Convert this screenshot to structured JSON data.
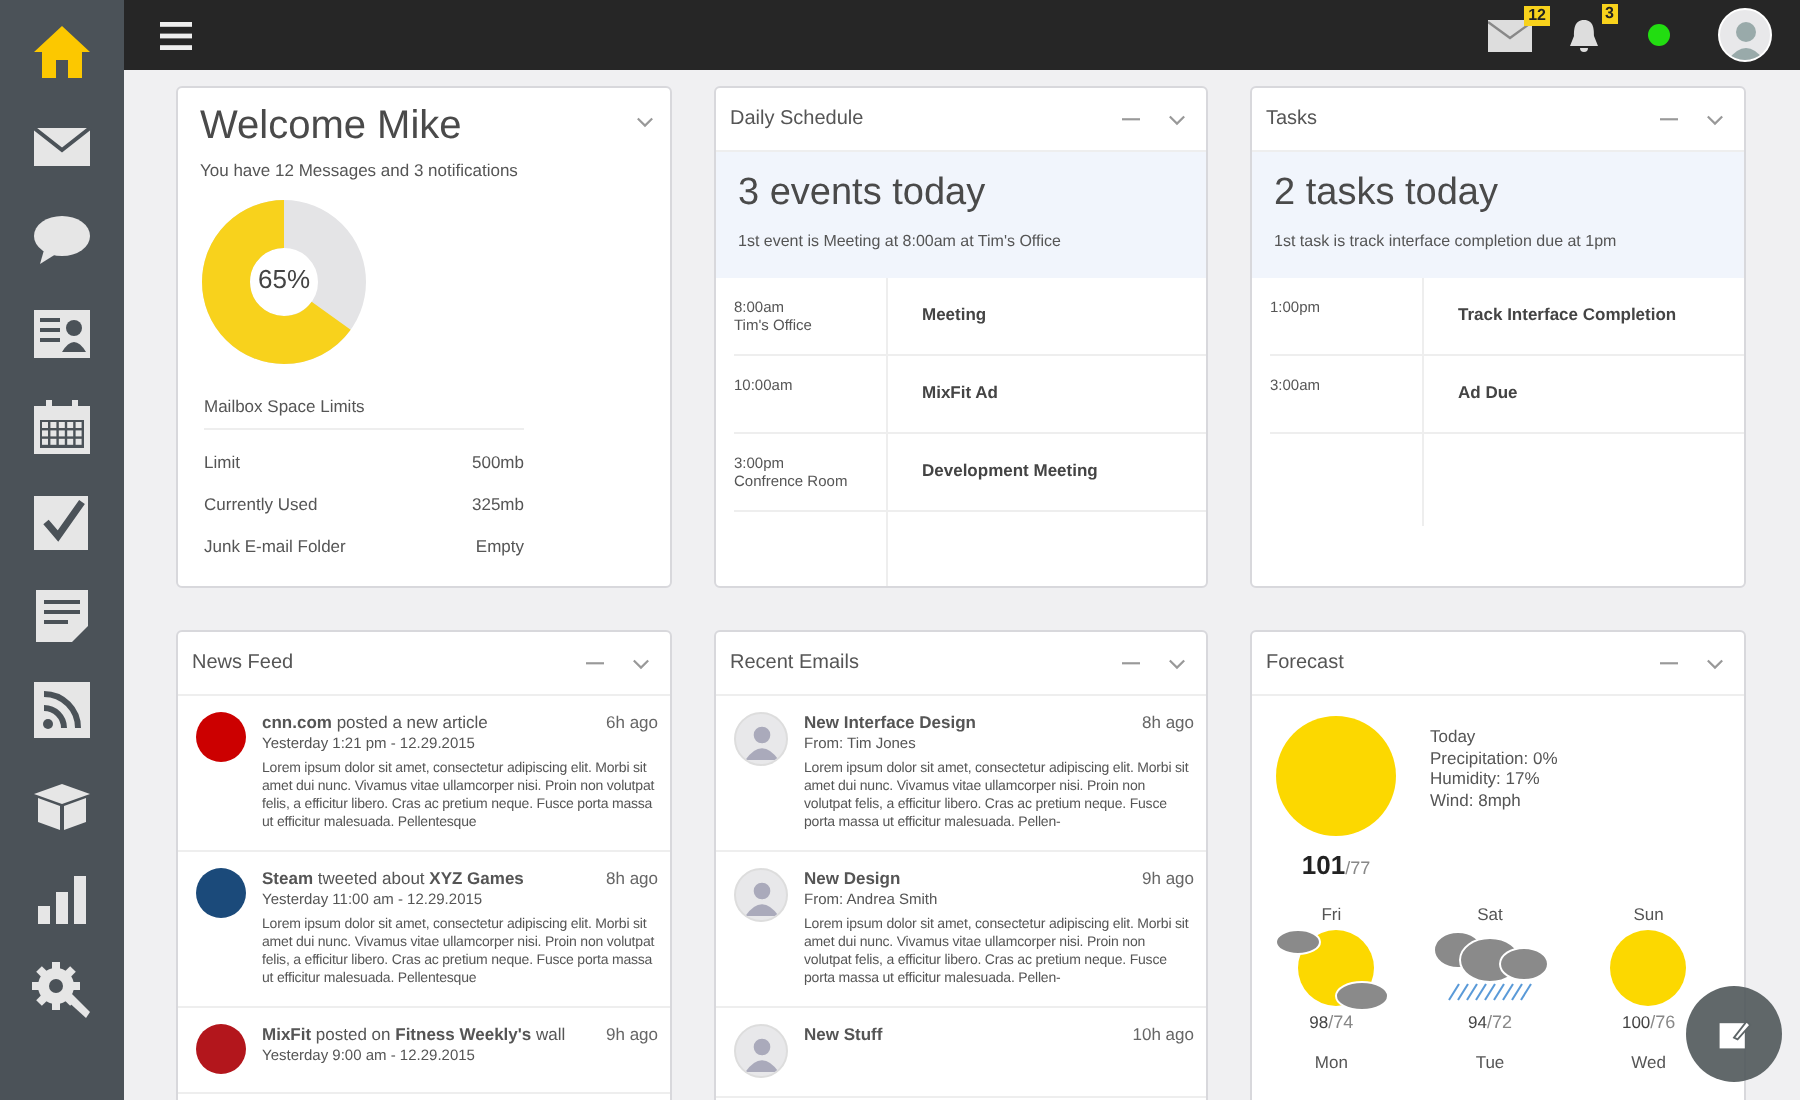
{
  "sidebar": {
    "items": [
      {
        "kind": "home",
        "selected": true
      },
      {
        "kind": "mail",
        "selected": false
      },
      {
        "kind": "chat",
        "selected": false
      },
      {
        "kind": "contacts",
        "selected": false
      },
      {
        "kind": "calendar",
        "selected": false
      },
      {
        "kind": "tasks",
        "selected": false
      },
      {
        "kind": "document",
        "selected": false
      },
      {
        "kind": "rss",
        "selected": false
      },
      {
        "kind": "box",
        "selected": false
      },
      {
        "kind": "stats",
        "selected": false
      },
      {
        "kind": "settings",
        "selected": false
      }
    ]
  },
  "topbar": {
    "mail_badge": "12",
    "notification_badge": "3",
    "online": true
  },
  "welcome": {
    "title": "Welcome Mike",
    "subtitle": "You have 12 Messages  and 3 notifications",
    "usage": {
      "level": 0.65,
      "label": "65%"
    },
    "limits_title": "Mailbox Space Limits",
    "limits": [
      {
        "label": "Limit",
        "value": "500mb"
      },
      {
        "label": "Currently Used",
        "value": "325mb"
      },
      {
        "label": "Junk E-mail Folder",
        "value": "Empty"
      }
    ]
  },
  "schedule": {
    "title": "Daily Schedule",
    "headline": "3 events today",
    "summary": "1st event is Meeting at 8:00am at Tim's Office",
    "events": [
      {
        "time": "8:00am",
        "place": "Tim's Office",
        "name": "Meeting"
      },
      {
        "time": "10:00am",
        "name": "MixFit Ad"
      },
      {
        "time": "3:00pm",
        "place": "Confrence Room",
        "name": "Development Meeting"
      }
    ]
  },
  "tasks": {
    "title": "Tasks",
    "headline": "2 tasks today",
    "summary": "1st task is track interface completion due at 1pm",
    "items": [
      {
        "time": "1:00pm",
        "name": "Track Interface Completion"
      },
      {
        "time": "3:00am",
        "name": "Ad Due"
      }
    ]
  },
  "news_feed": {
    "title": "News Feed",
    "items": [
      {
        "headline": "**cnn.com** posted a new article",
        "date": "Yesterday 1:21 pm - 12.29.2015",
        "ago": "6h ago",
        "color": "#cc0000",
        "body": "Lorem ipsum dolor sit amet, consectetur adipiscing elit. Morbi sit amet dui nunc. Vivamus vitae ullamcorper nisi. Proin non volutpat felis, a efficitur libero. Cras ac pretium neque. Fusce porta massa ut efficitur malesuada. Pellentesque"
      },
      {
        "headline": "**Steam** tweeted about **XYZ Games**",
        "date": "Yesterday 11:00 am - 12.29.2015",
        "ago": "8h ago",
        "color": "#1b4a7a",
        "body": "Lorem ipsum dolor sit amet, consectetur adipiscing elit. Morbi sit amet dui nunc. Vivamus vitae ullamcorper nisi. Proin non volutpat felis, a efficitur libero. Cras ac pretium neque. Fusce porta massa ut efficitur malesuada. Pellentesque"
      },
      {
        "headline": "**MixFit** posted on **Fitness Weekly's** wall",
        "date": "Yesterday 9:00 am - 12.29.2015",
        "ago": "9h ago",
        "color": "#b3161c"
      }
    ]
  },
  "recent_emails": {
    "title": "Recent Emails",
    "items": [
      {
        "subject": "New Interface Design",
        "from": "From: Tim Jones",
        "ago": "8h ago",
        "body": "Lorem ipsum dolor sit amet, consectetur adipiscing elit. Morbi sit amet dui nunc. Vivamus vitae ullamcorper nisi. Proin non volutpat felis, a efficitur libero. Cras ac pretium neque. Fusce porta massa ut efficitur malesuada. Pellen-"
      },
      {
        "subject": "New Design",
        "from": "From: Andrea Smith",
        "ago": "9h ago",
        "body": "Lorem ipsum dolor sit amet, consectetur adipiscing elit. Morbi sit amet dui nunc. Vivamus vitae ullamcorper nisi. Proin non volutpat felis, a efficitur libero. Cras ac pretium neque. Fusce porta massa ut efficitur malesuada. Pellen-"
      },
      {
        "subject": "New Stuff",
        "ago": "10h ago"
      }
    ]
  },
  "forecast": {
    "title": "Forecast",
    "today": {
      "kind": "sunny",
      "high": "101",
      "low": "/77",
      "details": [
        "Today",
        "Precipitation: 0%",
        "Humidity: 17%",
        "Wind: 8mph"
      ]
    },
    "days": [
      {
        "day": "Fri",
        "kind": "partly-cloudy",
        "high": "98",
        "low": "/74"
      },
      {
        "day": "Sat",
        "kind": "rain",
        "high": "94",
        "low": "/72"
      },
      {
        "day": "Sun",
        "kind": "sunny",
        "high": "100",
        "low": "/76"
      },
      {
        "day": "Mon"
      },
      {
        "day": "Tue"
      },
      {
        "day": "Wed"
      }
    ]
  }
}
